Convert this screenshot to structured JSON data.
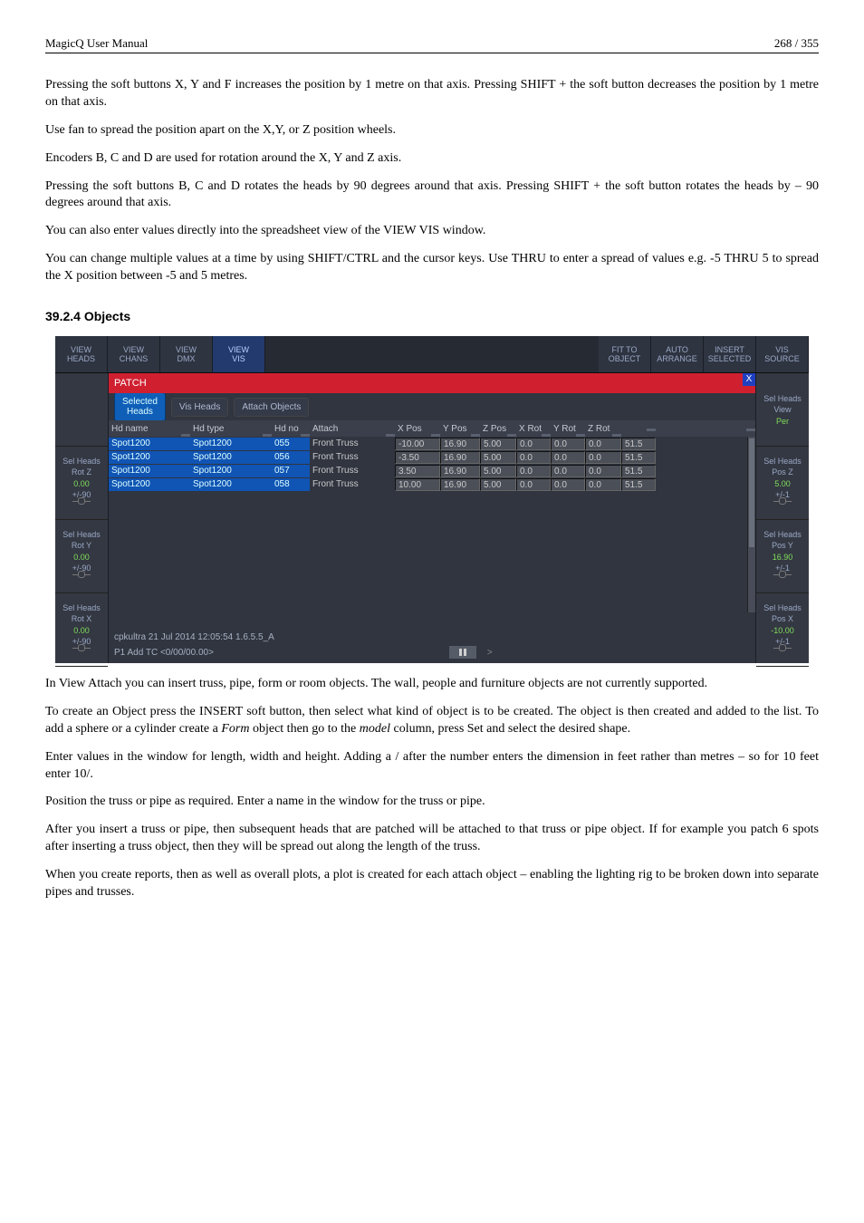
{
  "header": {
    "left": "MagicQ User Manual",
    "right": "268 / 355"
  },
  "para1": "Pressing the soft buttons X, Y and F increases the position by 1 metre on that axis. Pressing SHIFT + the soft button decreases the position by 1 metre on that axis.",
  "para2": "Use fan to spread the position apart on the X,Y, or Z position wheels.",
  "para3": "Encoders B, C and D are used for rotation around the X, Y and Z axis.",
  "para4": "Pressing the soft buttons B, C and D rotates the heads by 90 degrees around that axis. Pressing SHIFT + the soft button rotates the heads by – 90 degrees around that axis.",
  "para5": "You can also enter values directly into the spreadsheet view of the VIEW VIS window.",
  "para6": "You can change multiple values at a time by using SHIFT/CTRL and the cursor keys. Use THRU to enter a spread of values e.g. -5 THRU 5 to spread the X position between -5 and 5 metres.",
  "sectionTitle": "39.2.4   Objects",
  "top": {
    "viewHeads": "VIEW\nHEADS",
    "viewChans": "VIEW\nCHANS",
    "viewDmx": "VIEW\nDMX",
    "viewVis": "VIEW\nVIS",
    "fitObject": "FIT TO\nOBJECT",
    "autoArrange": "AUTO\nARRANGE",
    "insertSelected": "INSERT\nSELECTED",
    "visSource": "VIS\nSOURCE"
  },
  "tabLabel": "PATCH",
  "chips": {
    "selectedHeads": "Selected\nHeads",
    "visHeads": "Vis Heads",
    "attachObjects": "Attach Objects"
  },
  "cols": [
    "Hd name",
    "Hd type",
    "Hd no",
    "Attach",
    "X Pos",
    "Y Pos",
    "Z Pos",
    "X Rot",
    "Y Rot",
    "Z Rot",
    "",
    ""
  ],
  "rows": [
    {
      "hdname": "Spot1200",
      "hdtype": "Spot1200",
      "hdno": "055",
      "attach": "Front Truss",
      "xpos": "-10.00",
      "ypos": "16.90",
      "zpos": "5.00",
      "xrot": "0.0",
      "yrot": "0.0",
      "zrot": "0.0",
      "extra": "51.5"
    },
    {
      "hdname": "Spot1200",
      "hdtype": "Spot1200",
      "hdno": "056",
      "attach": "Front Truss",
      "xpos": "-3.50",
      "ypos": "16.90",
      "zpos": "5.00",
      "xrot": "0.0",
      "yrot": "0.0",
      "zrot": "0.0",
      "extra": "51.5"
    },
    {
      "hdname": "Spot1200",
      "hdtype": "Spot1200",
      "hdno": "057",
      "attach": "Front Truss",
      "xpos": "3.50",
      "ypos": "16.90",
      "zpos": "5.00",
      "xrot": "0.0",
      "yrot": "0.0",
      "zrot": "0.0",
      "extra": "51.5"
    },
    {
      "hdname": "Spot1200",
      "hdtype": "Spot1200",
      "hdno": "058",
      "attach": "Front Truss",
      "xpos": "10.00",
      "ypos": "16.90",
      "zpos": "5.00",
      "xrot": "0.0",
      "yrot": "0.0",
      "zrot": "0.0",
      "extra": "51.5"
    }
  ],
  "left": {
    "b1l1": "Sel Heads",
    "b1l2": "Rot Z",
    "b1val": "0.00",
    "b1enc": "+/-90",
    "b2l1": "Sel Heads",
    "b2l2": "Rot Y",
    "b2val": "0.00",
    "b2enc": "+/-90",
    "b3l1": "Sel Heads",
    "b3l2": "Rot X",
    "b3val": "0.00",
    "b3enc": "+/-90"
  },
  "right": {
    "b0l1": "Sel Heads",
    "b0l2": "View",
    "b0val": "Per",
    "b1l1": "Sel Heads",
    "b1l2": "Pos Z",
    "b1val": "5.00",
    "b1enc": "+/-1",
    "b2l1": "Sel Heads",
    "b2l2": "Pos Y",
    "b2val": "16.90",
    "b2enc": "+/-1",
    "b3l1": "Sel Heads",
    "b3l2": "Pos X",
    "b3val": "-10.00",
    "b3enc": "+/-1"
  },
  "status": "cpkultra 21 Jul 2014 12:05:54 1.6.5.5_A",
  "cmd": "P1 Add TC <0/00/00.00>",
  "sep": ">",
  "paraA": "In View Attach you can insert truss, pipe, form or room objects.   The wall, people and furniture objects are not currently supported.",
  "paraB1": "To create an Object press the INSERT soft button, then select what kind of object is to be created. The object is then created and added to the list. To add a sphere or a cylinder create a ",
  "paraB_em1": "Form",
  "paraB2": " object then go to the ",
  "paraB_em2": "model",
  "paraB3": " column, press Set and select the desired shape.",
  "paraC": "Enter values in the window for length, width and height.  Adding a / after the number enters the dimension in feet rather than metres – so for 10 feet enter 10/.",
  "paraD": "Position the truss or pipe as required. Enter a name in the window for the truss or pipe.",
  "paraE": "After you insert a truss or pipe, then subsequent heads that are patched will be attached to that truss or pipe object.  If for example you patch 6 spots after inserting a truss object, then they will be spread out along the length of the truss.",
  "paraF": "When you create reports, then as well as overall plots, a plot is created for each attach object – enabling the lighting rig to be broken down into separate pipes and trusses."
}
